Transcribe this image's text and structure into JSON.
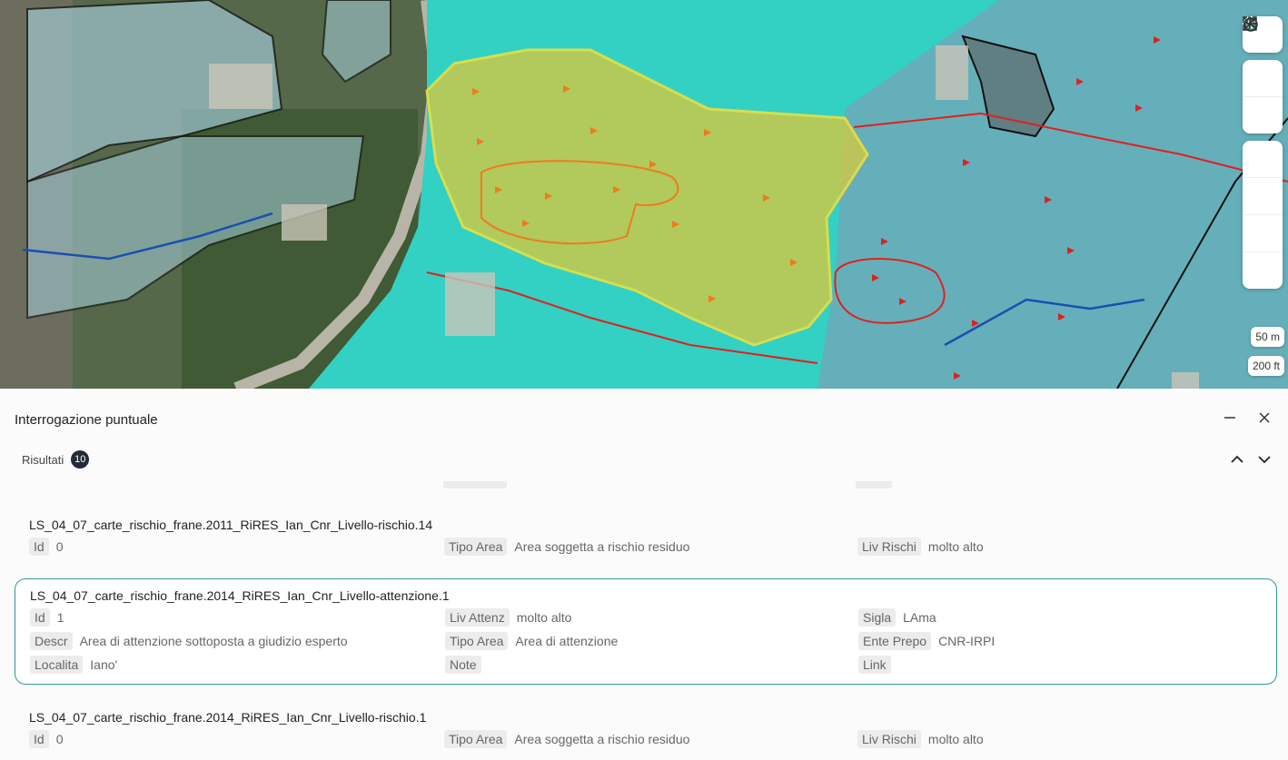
{
  "map": {
    "controls": [
      {
        "name": "fullscreen-icon"
      },
      {
        "name": "zoom-out-icon"
      },
      {
        "name": "zoom-in-icon"
      },
      {
        "name": "g-layer-icon"
      },
      {
        "name": "globe-icon"
      },
      {
        "name": "openai-icon"
      },
      {
        "name": "select-area-icon"
      }
    ],
    "scale_metric": "50 m",
    "scale_imperial": "200 ft"
  },
  "panel": {
    "title": "Interrogazione puntuale",
    "results_label": "Risultati",
    "results_count": "10"
  },
  "records": [
    {
      "title": "LS_04_07_carte_rischio_frane.2011_RiRES_Ian_Cnr_Livello-rischio.14",
      "fields": [
        {
          "key": "Id",
          "value": "0"
        },
        {
          "key": "Tipo Area",
          "value": "Area soggetta a rischio residuo"
        },
        {
          "key": "Liv Rischi",
          "value": "molto alto"
        }
      ]
    },
    {
      "title": "LS_04_07_carte_rischio_frane.2014_RiRES_Ian_Cnr_Livello-attenzione.1",
      "fields": [
        {
          "key": "Id",
          "value": "1"
        },
        {
          "key": "Liv Attenz",
          "value": "molto alto"
        },
        {
          "key": "Sigla",
          "value": "LAma"
        },
        {
          "key": "Descr",
          "value": "Area di attenzione sottoposta a giudizio esperto"
        },
        {
          "key": "Tipo Area",
          "value": "Area di attenzione"
        },
        {
          "key": "Ente Prepo",
          "value": "CNR-IRPI"
        },
        {
          "key": "Localita",
          "value": "Iano'"
        },
        {
          "key": "Note",
          "value": ""
        },
        {
          "key": "Link",
          "value": ""
        }
      ]
    },
    {
      "title": "LS_04_07_carte_rischio_frane.2014_RiRES_Ian_Cnr_Livello-rischio.1",
      "fields": [
        {
          "key": "Id",
          "value": "0"
        },
        {
          "key": "Tipo Area",
          "value": "Area soggetta a rischio residuo"
        },
        {
          "key": "Liv Rischi",
          "value": "molto alto"
        }
      ]
    }
  ]
}
